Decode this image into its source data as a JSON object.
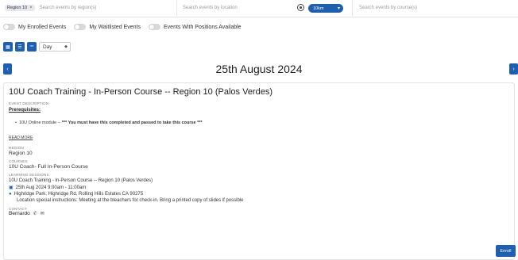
{
  "filters": {
    "region_chip": "Region 10",
    "region_chip_remove": "×",
    "region_placeholder": "Search events by region(s)",
    "location_placeholder": "Search events by location",
    "distance": "10km",
    "course_placeholder": "Search events by course(s)"
  },
  "toggles": {
    "enrolled": "My Enrolled Events",
    "waitlisted": "My Waitlisted Events",
    "positions": "Events With Positions Available"
  },
  "view": {
    "mode": "Day"
  },
  "date_heading": "25th August 2024",
  "event": {
    "title": "10U Coach Training - In-Person Course -- Region 10 (Palos Verdes)",
    "description_label": "EVENT DESCRIPTION",
    "prereq_label": "Prerequisites:",
    "bullet_prefix": "10U Online module --",
    "bullet_bold": "*** You must have this completed and passed to take this course ***",
    "read_more": "READ MORE",
    "region_label": "REGION",
    "region": "Region 10",
    "course_label": "COURSES",
    "course": "10U Coach- Full In-Person Course",
    "sessions_label": "LEARNING SESSIONS",
    "session_title": "10U Coach Training - In-Person Course -- Region 10 (Palos Verdes)",
    "session_datetime": "25th Aug 2024 9:00am - 11:00am",
    "session_location": "Highridge Park, Highridge Rd, Rolling Hills Estates CA 90275",
    "session_notes": "Location special instructions: Meeting at the bleachers for check-in. Bring a printed copy of slides if possible",
    "contact_label": "CONTACT",
    "contact": "Bernardo"
  },
  "enroll_label": "Enroll",
  "colors": {
    "accent": "#1f5fb0"
  }
}
